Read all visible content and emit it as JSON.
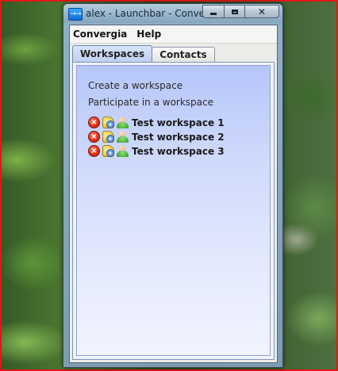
{
  "window": {
    "title": "alex - Launchbar - Convergia",
    "app_icon_glyph": "→→",
    "minimize_icon": "minimize-icon",
    "maximize_icon": "maximize-icon",
    "close_icon": "close-icon",
    "close_glyph": "✕"
  },
  "menubar": {
    "items": [
      {
        "label": "Convergia"
      },
      {
        "label": "Help"
      }
    ]
  },
  "tabs": [
    {
      "label": "Workspaces",
      "active": true
    },
    {
      "label": "Contacts",
      "active": false
    }
  ],
  "workspaces_panel": {
    "actions": [
      {
        "label": "Create a workspace"
      },
      {
        "label": "Participate in a workspace"
      }
    ],
    "items": [
      {
        "name": "Test workspace 1",
        "icons": [
          "remove-icon",
          "settings-icon",
          "users-icon"
        ]
      },
      {
        "name": "Test workspace 2",
        "icons": [
          "remove-icon",
          "settings-icon",
          "users-icon"
        ]
      },
      {
        "name": "Test workspace 3",
        "icons": [
          "remove-icon",
          "settings-icon",
          "users-icon"
        ]
      }
    ]
  },
  "colors": {
    "panel_gradient_top": "#b6c6fa",
    "panel_gradient_bottom": "#f2f4ff",
    "desktop_border": "#e01818"
  }
}
